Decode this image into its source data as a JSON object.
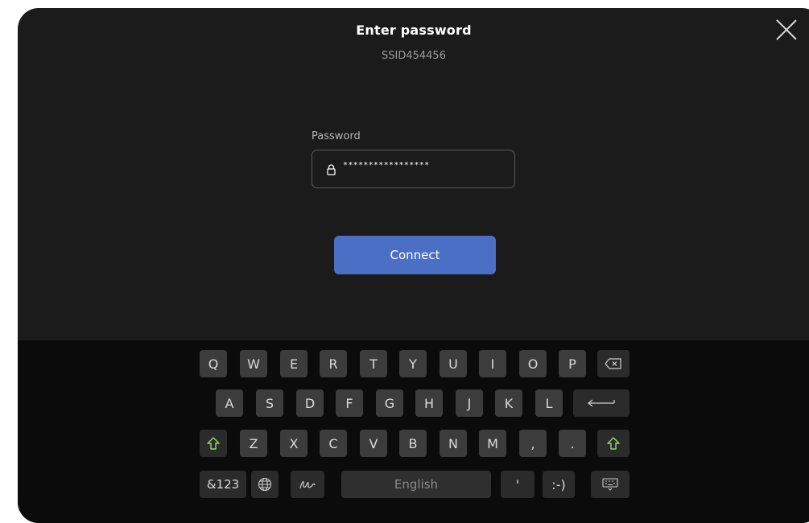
{
  "dialog": {
    "title": "Enter password",
    "subtitle": "SSID454456",
    "close_icon": "close-icon"
  },
  "password": {
    "label": "Password",
    "value": "*****************",
    "icon": "lock-icon"
  },
  "connect_label": "Connect",
  "keyboard": {
    "row1": [
      "Q",
      "W",
      "E",
      "R",
      "T",
      "Y",
      "U",
      "I",
      "O",
      "P"
    ],
    "row2": [
      "A",
      "S",
      "D",
      "F",
      "G",
      "H",
      "J",
      "K",
      "L"
    ],
    "row3": [
      "Z",
      "X",
      "C",
      "V",
      "B",
      "N",
      "M",
      ",",
      "."
    ],
    "symbols_label": "&123",
    "space_label": "English",
    "apostrophe": "'",
    "emoticon": ":-)",
    "icons": [
      "backspace-icon",
      "enter-icon",
      "shift-icon",
      "globe-icon",
      "handwriting-icon",
      "keyboard-hide-icon"
    ]
  },
  "colors": {
    "background": "#1b1b1b",
    "keyboard_bg": "#0b0b0b",
    "key": "#3c3c3c",
    "accent": "#4a6fc4",
    "shift_icon": "#9bd36a"
  }
}
